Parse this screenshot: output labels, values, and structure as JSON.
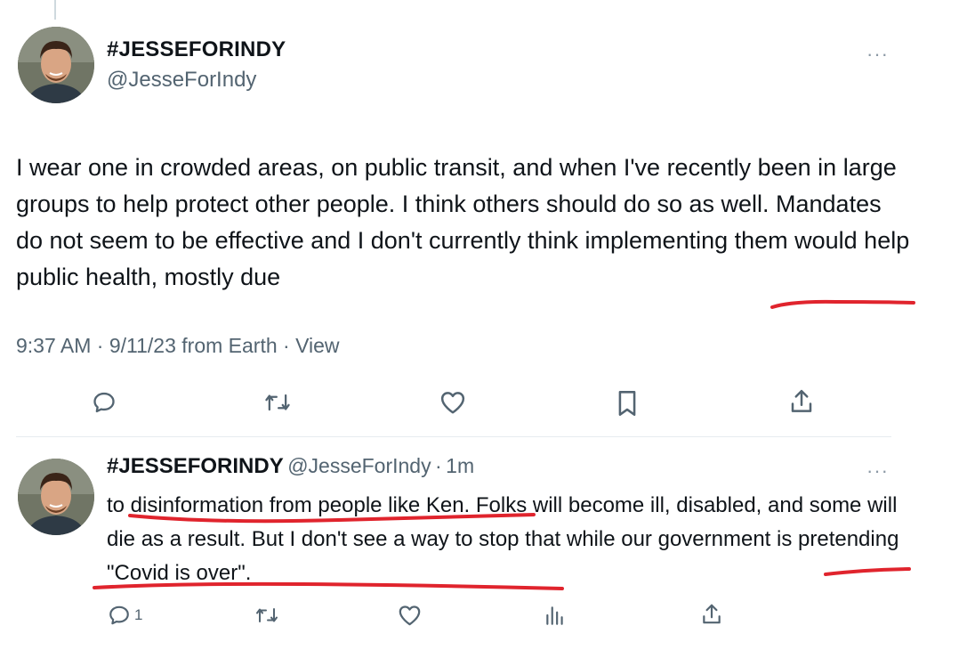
{
  "main_tweet": {
    "display_name": "#JESSEFORINDY",
    "handle": "@JesseForIndy",
    "more_label": "···",
    "text": "I wear one in crowded areas, on public transit, and when I've recently been in large groups to help protect other people. I think others should do so as well. Mandates do not seem to be effective and I don't currently think implementing them would help public health, mostly due",
    "time": "9:37 AM",
    "separator": "·",
    "date": "9/11/23",
    "source": "from Earth",
    "view_label": "View",
    "actions": {
      "reply_icon": "speech-bubble-icon",
      "retweet_icon": "retweet-icon",
      "like_icon": "heart-icon",
      "bookmark_icon": "bookmark-icon",
      "share_icon": "share-upload-icon"
    }
  },
  "reply_tweet": {
    "display_name": "#JESSEFORINDY",
    "handle": "@JesseForIndy",
    "dot": "·",
    "time": "1m",
    "more_label": "···",
    "text": "to disinformation from people like Ken. Folks will become ill, disabled, and some will die as a result. But I don't see a way to stop that while our government is pretending \"Covid is over\".",
    "reply_count": "1",
    "actions": {
      "reply_icon": "speech-bubble-icon",
      "retweet_icon": "retweet-icon",
      "like_icon": "heart-icon",
      "views_icon": "bar-chart-icon",
      "share_icon": "share-upload-icon"
    }
  },
  "colors": {
    "text": "#0f1419",
    "secondary": "#536471",
    "annotation": "#e0242d",
    "divider": "#e6ecf0"
  }
}
